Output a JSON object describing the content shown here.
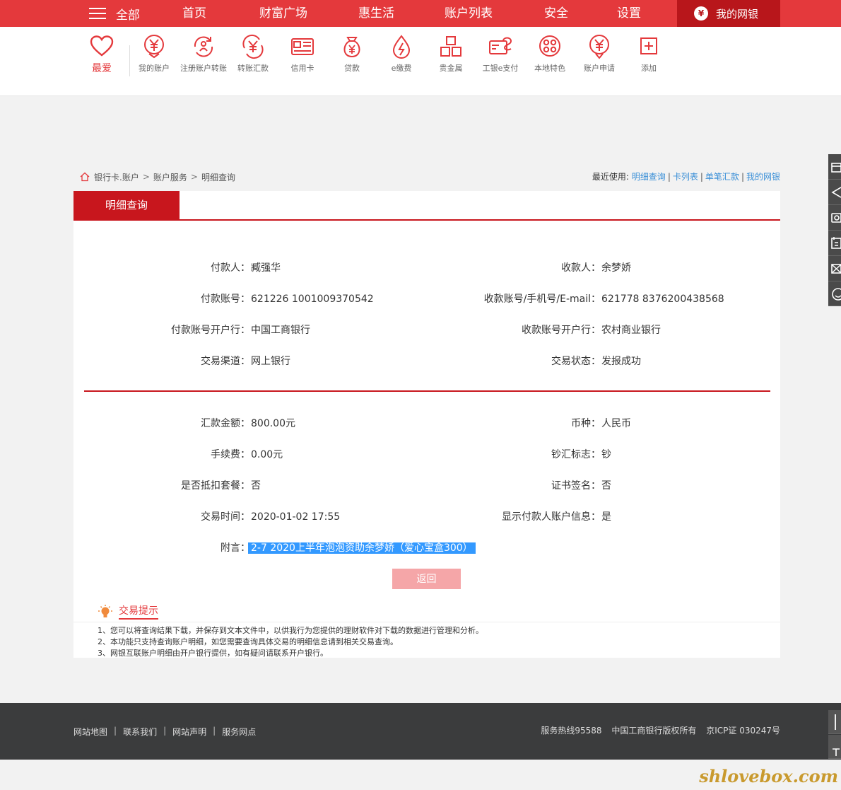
{
  "nav": {
    "menu_label": "全部",
    "items": [
      "首页",
      "财富广场",
      "惠生活",
      "账户列表",
      "安全",
      "设置"
    ],
    "mybank_label": "我的网银"
  },
  "favorites": {
    "heart_label": "最爱",
    "items": [
      {
        "label": "我的账户",
        "icon": "yuan-coin-icon"
      },
      {
        "label": "注册账户转账",
        "icon": "register-transfer-icon"
      },
      {
        "label": "转账汇款",
        "icon": "transfer-icon"
      },
      {
        "label": "信用卡",
        "icon": "credit-card-icon"
      },
      {
        "label": "贷款",
        "icon": "loan-bag-icon"
      },
      {
        "label": "e缴费",
        "icon": "payment-drop-icon"
      },
      {
        "label": "贵金属",
        "icon": "gold-bars-icon"
      },
      {
        "label": "工银e支付",
        "icon": "e-pay-icon"
      },
      {
        "label": "本地特色",
        "icon": "local-icon"
      },
      {
        "label": "账户申请",
        "icon": "apply-icon"
      },
      {
        "label": "添加",
        "icon": "add-icon"
      }
    ]
  },
  "breadcrumb": {
    "items": [
      "银行卡.账户",
      "账户服务",
      "明细查询"
    ],
    "sep": ">"
  },
  "recent": {
    "label": "最近使用:",
    "links": [
      "明细查询",
      "卡列表",
      "单笔汇款",
      "我的网银"
    ]
  },
  "panel": {
    "tab": "明细查询",
    "fields_left": [
      {
        "label": "付款人：",
        "value": "臧强华"
      },
      {
        "label": "付款账号：",
        "value": "621226 1001009370542"
      },
      {
        "label": "付款账号开户行：",
        "value": "中国工商银行"
      },
      {
        "label": "交易渠道：",
        "value": "网上银行"
      }
    ],
    "fields_right": [
      {
        "label": "收款人：",
        "value": "余梦娇"
      },
      {
        "label": "收款账号/手机号/E-mail：",
        "value": "621778 8376200438568"
      },
      {
        "label": "收款账号开户行：",
        "value": "农村商业银行"
      },
      {
        "label": "交易状态：",
        "value": "发报成功"
      }
    ],
    "fields2_left": [
      {
        "label": "汇款金额：",
        "value": "800.00元"
      },
      {
        "label": "手续费：",
        "value": "0.00元"
      },
      {
        "label": "是否抵扣套餐：",
        "value": "否"
      },
      {
        "label": "交易时间：",
        "value": "2020-01-02 17:55"
      }
    ],
    "fields2_right": [
      {
        "label": "币种：",
        "value": "人民币"
      },
      {
        "label": "钞汇标志：",
        "value": "钞"
      },
      {
        "label": "证书签名：",
        "value": "否"
      },
      {
        "label": "显示付款人账户信息：",
        "value": "是"
      }
    ],
    "memo": {
      "label": "附言：",
      "value": "2-7 2020上半年泡泡资助余梦娇（爱心宝盒300）"
    },
    "back_button": "返回"
  },
  "tips": {
    "title": "交易提示",
    "lines": [
      "1、您可以将查询结果下载，并保存到文本文件中，以供我行为您提供的理财软件对下载的数据进行管理和分析。",
      "2、本功能只支持查询账户明细，如您需要查询具体交易的明细信息请到相关交易查询。",
      "3、网银互联账户明细由开户银行提供，如有疑问请联系开户银行。"
    ]
  },
  "footer": {
    "links": [
      "网站地图",
      "联系我们",
      "网站声明",
      "服务网点"
    ],
    "hotline": "服务热线95588",
    "copyright": "中国工商银行版权所有",
    "icp": "京ICP证 030247号"
  },
  "watermark": "shlovebox.com",
  "side_tools": [
    "gift-icon",
    "send-icon",
    "camera-icon",
    "calendar-icon",
    "mail-icon",
    "service-icon"
  ],
  "side_tools_bottom": [
    "scroll-handle-icon",
    "back-to-top-icon"
  ],
  "colors": {
    "brand_red": "#e4393c",
    "dark_red": "#c8161d",
    "link_blue": "#3a8fd7",
    "memo_highlight": "#3399ff"
  }
}
